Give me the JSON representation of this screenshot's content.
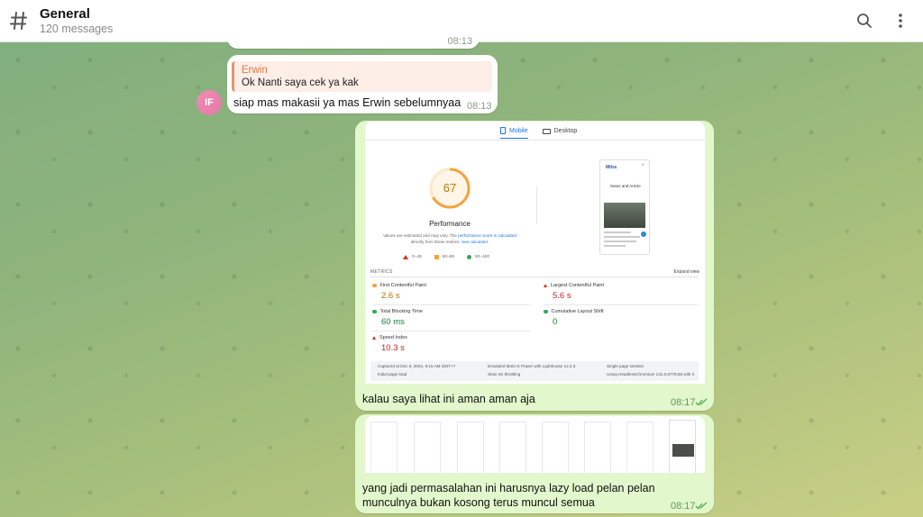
{
  "header": {
    "title": "General",
    "subtitle": "120 messages"
  },
  "icons": {
    "channel": "hash-icon",
    "search": "search-icon",
    "menu": "more-vertical-icon",
    "read": "double-check-icon"
  },
  "colors": {
    "outgoing_bubble": "#e2f7cc",
    "incoming_bubble": "#ffffff",
    "reply_accent": "#e69468",
    "avatar": "#e27aa6",
    "read_check": "#4fae4e"
  },
  "messages": [
    {
      "id": "partial-top",
      "direction": "incoming",
      "time": "08:13"
    },
    {
      "id": "m1",
      "direction": "incoming",
      "avatar_initials": "IF",
      "reply_to": {
        "name": "Erwin",
        "text": "Ok Nanti saya cek ya kak"
      },
      "text": "siap mas makasii ya mas Erwin sebelumnyaa",
      "time": "08:13"
    },
    {
      "id": "m2",
      "direction": "outgoing",
      "text": "kalau saya lihat ini aman aman aja",
      "time": "08:17"
    },
    {
      "id": "m3",
      "direction": "outgoing",
      "text_line1": "yang jadi permasalahan ini harusnya lazy load pelan pelan",
      "text_line2": "munculnya bukan kosong terus muncul semua",
      "time": "08:17"
    }
  ],
  "screenshot": {
    "tab_mobile": "Mobile",
    "tab_desktop": "Desktop",
    "score": "67",
    "score_fraction": 0.67,
    "score_label": "Performance",
    "note_text": "Values are estimated and may vary. The",
    "note_link": "performance score is calculated",
    "note_text2": "directly from these metrics.",
    "note_link2": "See calculator.",
    "legend": [
      "0–49",
      "50–89",
      "90–100"
    ],
    "phone_logo": "Mitra",
    "phone_heading": "News and Article",
    "metrics_title": "METRICS",
    "expand_view": "Expand view",
    "metrics": [
      {
        "name": "First Contentful Paint",
        "value": "2.6 s",
        "rating": "average"
      },
      {
        "name": "Largest Contentful Paint",
        "value": "5.6 s",
        "rating": "poor"
      },
      {
        "name": "Total Blocking Time",
        "value": "60 ms",
        "rating": "good"
      },
      {
        "name": "Cumulative Layout Shift",
        "value": "0",
        "rating": "good"
      },
      {
        "name": "Speed Index",
        "value": "10.3 s",
        "rating": "poor"
      }
    ],
    "footer": {
      "captured": "Captured at Dec 6, 2024, 8:15 AM GMT+7",
      "emulated": "Emulated Moto G Power with Lighthouse 12.2.3",
      "session": "Single page session",
      "initial": "Initial page load",
      "throttling": "Slow 4G throttling",
      "browser": "Using HeadlessChromium 131.0.6778.85 with lr"
    }
  }
}
